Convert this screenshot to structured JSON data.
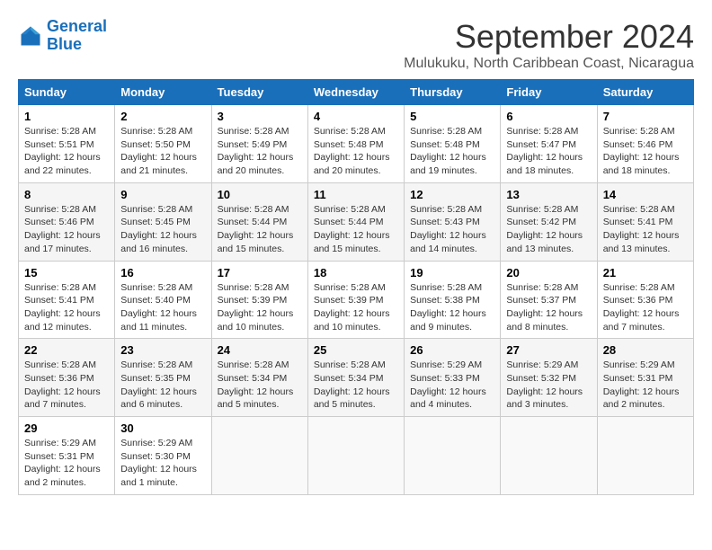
{
  "logo": {
    "line1": "General",
    "line2": "Blue"
  },
  "title": "September 2024",
  "subtitle": "Mulukuku, North Caribbean Coast, Nicaragua",
  "headers": [
    "Sunday",
    "Monday",
    "Tuesday",
    "Wednesday",
    "Thursday",
    "Friday",
    "Saturday"
  ],
  "weeks": [
    [
      {
        "day": "1",
        "info": "Sunrise: 5:28 AM\nSunset: 5:51 PM\nDaylight: 12 hours\nand 22 minutes."
      },
      {
        "day": "2",
        "info": "Sunrise: 5:28 AM\nSunset: 5:50 PM\nDaylight: 12 hours\nand 21 minutes."
      },
      {
        "day": "3",
        "info": "Sunrise: 5:28 AM\nSunset: 5:49 PM\nDaylight: 12 hours\nand 20 minutes."
      },
      {
        "day": "4",
        "info": "Sunrise: 5:28 AM\nSunset: 5:48 PM\nDaylight: 12 hours\nand 20 minutes."
      },
      {
        "day": "5",
        "info": "Sunrise: 5:28 AM\nSunset: 5:48 PM\nDaylight: 12 hours\nand 19 minutes."
      },
      {
        "day": "6",
        "info": "Sunrise: 5:28 AM\nSunset: 5:47 PM\nDaylight: 12 hours\nand 18 minutes."
      },
      {
        "day": "7",
        "info": "Sunrise: 5:28 AM\nSunset: 5:46 PM\nDaylight: 12 hours\nand 18 minutes."
      }
    ],
    [
      {
        "day": "8",
        "info": "Sunrise: 5:28 AM\nSunset: 5:46 PM\nDaylight: 12 hours\nand 17 minutes."
      },
      {
        "day": "9",
        "info": "Sunrise: 5:28 AM\nSunset: 5:45 PM\nDaylight: 12 hours\nand 16 minutes."
      },
      {
        "day": "10",
        "info": "Sunrise: 5:28 AM\nSunset: 5:44 PM\nDaylight: 12 hours\nand 15 minutes."
      },
      {
        "day": "11",
        "info": "Sunrise: 5:28 AM\nSunset: 5:44 PM\nDaylight: 12 hours\nand 15 minutes."
      },
      {
        "day": "12",
        "info": "Sunrise: 5:28 AM\nSunset: 5:43 PM\nDaylight: 12 hours\nand 14 minutes."
      },
      {
        "day": "13",
        "info": "Sunrise: 5:28 AM\nSunset: 5:42 PM\nDaylight: 12 hours\nand 13 minutes."
      },
      {
        "day": "14",
        "info": "Sunrise: 5:28 AM\nSunset: 5:41 PM\nDaylight: 12 hours\nand 13 minutes."
      }
    ],
    [
      {
        "day": "15",
        "info": "Sunrise: 5:28 AM\nSunset: 5:41 PM\nDaylight: 12 hours\nand 12 minutes."
      },
      {
        "day": "16",
        "info": "Sunrise: 5:28 AM\nSunset: 5:40 PM\nDaylight: 12 hours\nand 11 minutes."
      },
      {
        "day": "17",
        "info": "Sunrise: 5:28 AM\nSunset: 5:39 PM\nDaylight: 12 hours\nand 10 minutes."
      },
      {
        "day": "18",
        "info": "Sunrise: 5:28 AM\nSunset: 5:39 PM\nDaylight: 12 hours\nand 10 minutes."
      },
      {
        "day": "19",
        "info": "Sunrise: 5:28 AM\nSunset: 5:38 PM\nDaylight: 12 hours\nand 9 minutes."
      },
      {
        "day": "20",
        "info": "Sunrise: 5:28 AM\nSunset: 5:37 PM\nDaylight: 12 hours\nand 8 minutes."
      },
      {
        "day": "21",
        "info": "Sunrise: 5:28 AM\nSunset: 5:36 PM\nDaylight: 12 hours\nand 7 minutes."
      }
    ],
    [
      {
        "day": "22",
        "info": "Sunrise: 5:28 AM\nSunset: 5:36 PM\nDaylight: 12 hours\nand 7 minutes."
      },
      {
        "day": "23",
        "info": "Sunrise: 5:28 AM\nSunset: 5:35 PM\nDaylight: 12 hours\nand 6 minutes."
      },
      {
        "day": "24",
        "info": "Sunrise: 5:28 AM\nSunset: 5:34 PM\nDaylight: 12 hours\nand 5 minutes."
      },
      {
        "day": "25",
        "info": "Sunrise: 5:28 AM\nSunset: 5:34 PM\nDaylight: 12 hours\nand 5 minutes."
      },
      {
        "day": "26",
        "info": "Sunrise: 5:29 AM\nSunset: 5:33 PM\nDaylight: 12 hours\nand 4 minutes."
      },
      {
        "day": "27",
        "info": "Sunrise: 5:29 AM\nSunset: 5:32 PM\nDaylight: 12 hours\nand 3 minutes."
      },
      {
        "day": "28",
        "info": "Sunrise: 5:29 AM\nSunset: 5:31 PM\nDaylight: 12 hours\nand 2 minutes."
      }
    ],
    [
      {
        "day": "29",
        "info": "Sunrise: 5:29 AM\nSunset: 5:31 PM\nDaylight: 12 hours\nand 2 minutes."
      },
      {
        "day": "30",
        "info": "Sunrise: 5:29 AM\nSunset: 5:30 PM\nDaylight: 12 hours\nand 1 minute."
      },
      null,
      null,
      null,
      null,
      null
    ]
  ]
}
